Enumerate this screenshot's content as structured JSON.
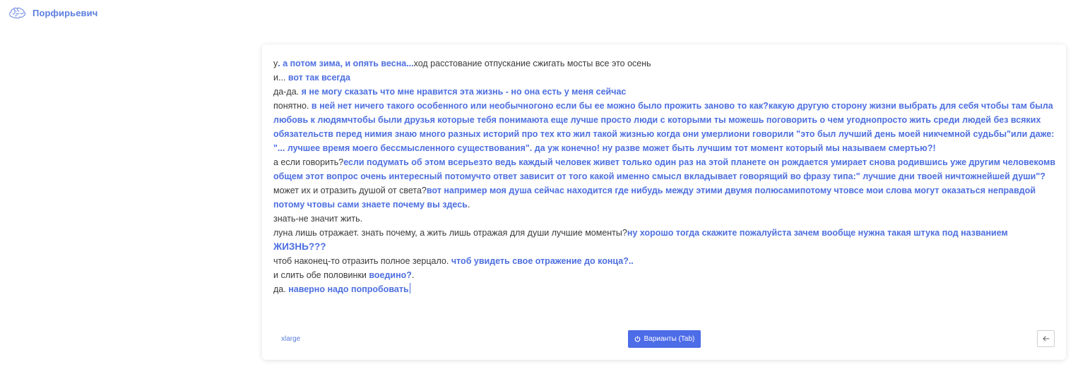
{
  "header": {
    "title": "Порфирьевич",
    "logo_icon": "brain-icon"
  },
  "editor": {
    "lines": [
      {
        "user": "у",
        "gen": ". а потом зима, и опять весна...",
        "tail": "ход расстование отпускание сжигать мосты все это осень"
      },
      {
        "user": "и... ",
        "gen": "вот так всегда",
        "tail": ""
      },
      {
        "user": "да-да. ",
        "gen": "я не могу сказать что мне нравится эта жизнь - но она есть у меня сейчас",
        "tail": ""
      },
      {
        "user": "понятно. ",
        "gen": "в ней нет ничего такого особенного или необычногоно если бы ее можно было прожить заново то как?какую другую сторону жизни выбрать для себя чтобы там была любовь к людямчтобы были друзья которые тебя понимаюта еще лучше просто люди с которыми ты можешь поговорить о чем угоднопросто жить среди людей без всяких обязательств перед нимия знаю много разных историй про тех кто жил такой жизнью когда они умерлиони говорили \"это был лучший день моей никчемной судьбы\"или даже: \"... лучшее время моего бессмысленного существования\". да уж конечно! ну разве может быть лучшим тот момент который мы называем смертью?!",
        "tail": ""
      },
      {
        "user": "а если говорить?",
        "gen": "если подумать об этом всерьезто ведь каждый человек живет только один раз на этой планете он рождается умирает снова родившись уже другим человекомв общем этот вопрос очень интересный потомучто ответ зависит от того какой именно смысл вкладывает говорящий во фразу типа:\" лучшие дни твоей ничтожнейшей души\"?",
        "tail": ""
      },
      {
        "user": "может их и отразить душой от света?",
        "gen": "вот например моя душа сейчас находится где нибудь между этими двумя полюсамипотому чтовсе мои слова могут оказаться неправдой потому чтовы сами знаете почему вы здесь",
        "tail": "."
      },
      {
        "user": "знать-не значит жить.",
        "gen": "",
        "tail": ""
      },
      {
        "user": "луна лишь отражает. знать почему, а жить лишь отражая для души лучшие моменты?",
        "gen": "ну хорошо тогда скажите пожалуйста зачем вообще нужна такая штука под названием ",
        "gen_big": "ЖИЗНЬ???",
        "tail": ""
      },
      {
        "user": "чтоб наконец-то отразить полное зерцало. ",
        "gen": "чтоб увидеть свое отражение до конца?..",
        "tail": ""
      },
      {
        "user": "и слить обе половинки ",
        "gen": "воедино?",
        "tail": "."
      },
      {
        "user": "да. ",
        "gen": "наверно надо попробовать",
        "tail": ""
      }
    ]
  },
  "footer": {
    "model": "xlarge",
    "variants_label": "Варианты (Tab)",
    "variants_icon": "power-icon",
    "back_icon": "arrow-left-icon"
  },
  "colors": {
    "accent": "#4d6ce8",
    "generated_text": "#4d6fe0",
    "user_text": "#3a3a3a"
  }
}
